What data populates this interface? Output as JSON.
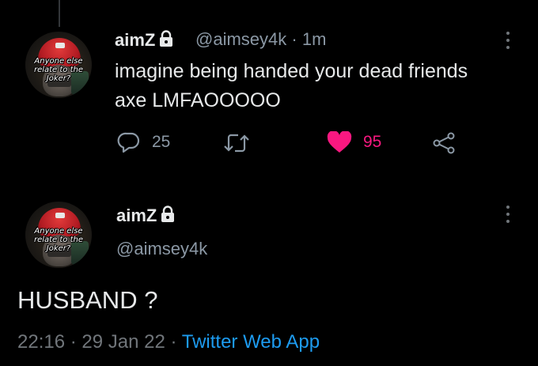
{
  "reply_tweet": {
    "display_name": "aimZ",
    "handle": "@aimsey4k",
    "separator": "·",
    "time": "1m",
    "text_line1": "imagine being handed your dead friends",
    "text_line2": "axe LMFAOOOOO",
    "reply_count": "25",
    "like_count": "95",
    "avatar_caption": "Anyone else relate to the Joker?"
  },
  "main_tweet": {
    "display_name": "aimZ",
    "handle": "@aimsey4k",
    "text": "HUSBAND ?",
    "time": "22:16",
    "dot1": "·",
    "date": "29 Jan 22",
    "dot2": "·",
    "source": "Twitter Web App",
    "avatar_caption": "Anyone else relate to the Joker?"
  },
  "icons": {
    "lock": "lock-icon",
    "reply": "reply-icon",
    "retweet": "retweet-icon",
    "like": "heart-icon",
    "share": "share-icon",
    "more": "more-icon"
  },
  "colors": {
    "background": "#000000",
    "text": "#e7e9ea",
    "secondary": "#71767b",
    "like": "#f91880",
    "link": "#1d9bf0"
  }
}
